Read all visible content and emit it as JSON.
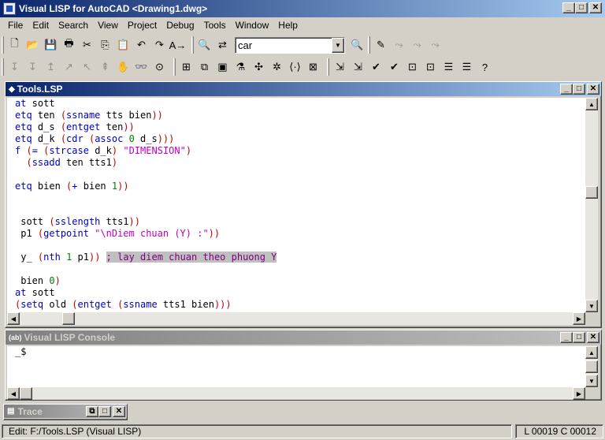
{
  "window": {
    "title": "Visual LISP for AutoCAD <Drawing1.dwg>"
  },
  "menu": [
    "File",
    "Edit",
    "Search",
    "View",
    "Project",
    "Debug",
    "Tools",
    "Window",
    "Help"
  ],
  "toolbar": {
    "search_value": "car"
  },
  "editor": {
    "title": "Tools.LSP",
    "lines": [
      [
        [
          "kw",
          "at"
        ],
        [
          "tx",
          " sott"
        ]
      ],
      [
        [
          "kw",
          "etq"
        ],
        [
          "tx",
          " ten "
        ],
        [
          "pr",
          "("
        ],
        [
          "kw",
          "ssname"
        ],
        [
          "tx",
          " tts bien"
        ],
        [
          "pr",
          "))"
        ]
      ],
      [
        [
          "kw",
          "etq"
        ],
        [
          "tx",
          " d_s "
        ],
        [
          "pr",
          "("
        ],
        [
          "kw",
          "entget"
        ],
        [
          "tx",
          " ten"
        ],
        [
          "pr",
          "))"
        ]
      ],
      [
        [
          "kw",
          "etq"
        ],
        [
          "tx",
          " d_k "
        ],
        [
          "pr",
          "("
        ],
        [
          "kw",
          "cdr"
        ],
        [
          "tx",
          " "
        ],
        [
          "pr",
          "("
        ],
        [
          "kw",
          "assoc"
        ],
        [
          "tx",
          " "
        ],
        [
          "nm",
          "0"
        ],
        [
          "tx",
          " d_s"
        ],
        [
          "pr",
          ")))"
        ]
      ],
      [
        [
          "kw",
          "f"
        ],
        [
          "tx",
          " "
        ],
        [
          "pr",
          "("
        ],
        [
          "kw",
          "="
        ],
        [
          "tx",
          " "
        ],
        [
          "pr",
          "("
        ],
        [
          "kw",
          "strcase"
        ],
        [
          "tx",
          " d_k"
        ],
        [
          "pr",
          ")"
        ],
        [
          "tx",
          " "
        ],
        [
          "st",
          "\"DIMENSION\""
        ],
        [
          "pr",
          ")"
        ]
      ],
      [
        [
          "tx",
          "  "
        ],
        [
          "pr",
          "("
        ],
        [
          "kw",
          "ssadd"
        ],
        [
          "tx",
          " ten tts1"
        ],
        [
          "pr",
          ")"
        ]
      ],
      [
        [
          "tx",
          ""
        ]
      ],
      [
        [
          "kw",
          "etq"
        ],
        [
          "tx",
          " bien "
        ],
        [
          "pr",
          "("
        ],
        [
          "kw",
          "+"
        ],
        [
          "tx",
          " bien "
        ],
        [
          "nm",
          "1"
        ],
        [
          "pr",
          "))"
        ]
      ],
      [
        [
          "tx",
          ""
        ]
      ],
      [
        [
          "tx",
          ""
        ]
      ],
      [
        [
          "tx",
          " sott "
        ],
        [
          "pr",
          "("
        ],
        [
          "kw",
          "sslength"
        ],
        [
          "tx",
          " tts1"
        ],
        [
          "pr",
          "))"
        ]
      ],
      [
        [
          "tx",
          " p1 "
        ],
        [
          "pr",
          "("
        ],
        [
          "kw",
          "getpoint"
        ],
        [
          "tx",
          " "
        ],
        [
          "st",
          "\"\\nDiem chuan (Y) :\""
        ],
        [
          "pr",
          "))"
        ]
      ],
      [
        [
          "tx",
          ""
        ]
      ],
      [
        [
          "tx",
          " y_ "
        ],
        [
          "pr",
          "("
        ],
        [
          "kw",
          "nth"
        ],
        [
          "tx",
          " "
        ],
        [
          "nm",
          "1"
        ],
        [
          "tx",
          " p1"
        ],
        [
          "pr",
          "))"
        ],
        [
          "tx",
          " "
        ],
        [
          "cm",
          "; lay diem chuan theo phuong Y"
        ]
      ],
      [
        [
          "tx",
          ""
        ]
      ],
      [
        [
          "tx",
          " bien "
        ],
        [
          "nm",
          "0"
        ],
        [
          "pr",
          ")"
        ]
      ],
      [
        [
          "kw",
          "at"
        ],
        [
          "tx",
          " sott"
        ]
      ],
      [
        [
          "pr",
          "("
        ],
        [
          "kw",
          "setq"
        ],
        [
          "tx",
          " old "
        ],
        [
          "pr",
          "("
        ],
        [
          "kw",
          "entget"
        ],
        [
          "tx",
          " "
        ],
        [
          "pr",
          "("
        ],
        [
          "kw",
          "ssname"
        ],
        [
          "tx",
          " tts1 bien"
        ],
        [
          "pr",
          ")))"
        ]
      ]
    ]
  },
  "console": {
    "title": "Visual LISP Console",
    "prompt": "_$"
  },
  "trace": {
    "title": "Trace"
  },
  "status": {
    "left": "Edit:  F:/Tools.LSP   (Visual LISP)",
    "right": "L 00019  C 00012"
  }
}
